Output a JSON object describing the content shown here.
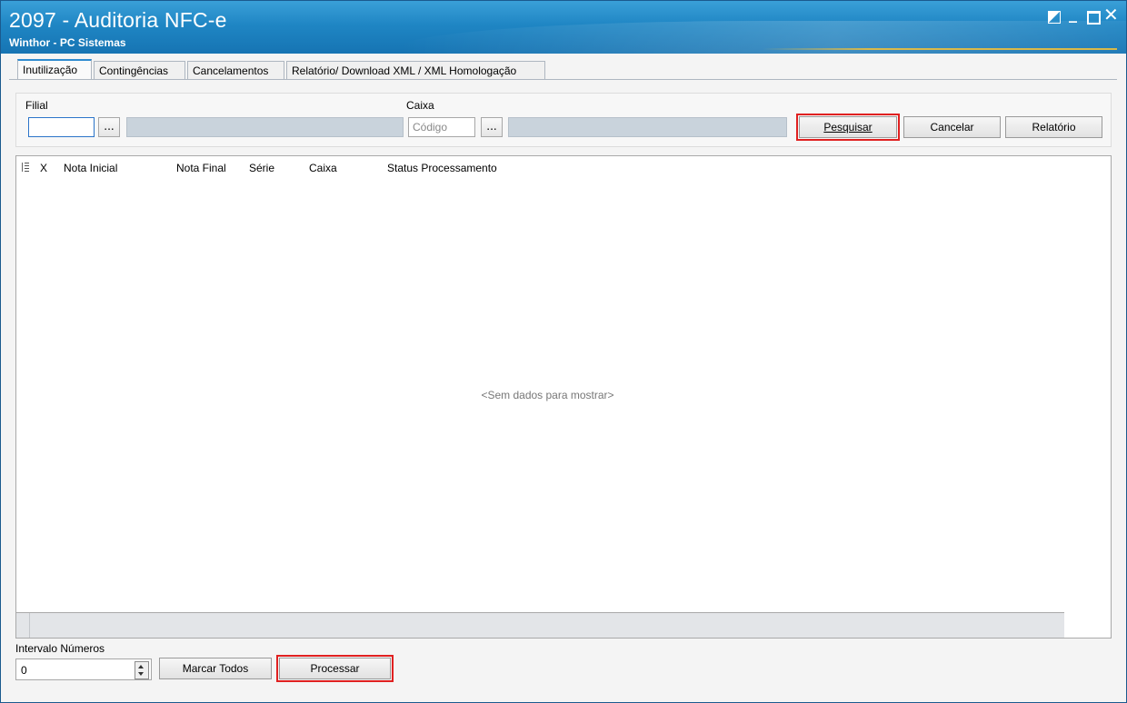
{
  "window": {
    "title": "2097 - Auditoria NFC-e",
    "subtitle": "Winthor - PC Sistemas"
  },
  "tabs": [
    {
      "label": "Inutilização",
      "active": true
    },
    {
      "label": "Contingências",
      "active": false
    },
    {
      "label": "Cancelamentos",
      "active": false
    },
    {
      "label": "Relatório/ Download XML / XML Homologação",
      "active": false
    }
  ],
  "filters": {
    "filial_label": "Filial",
    "filial_value": "",
    "ellipsis": "...",
    "caixa_label": "Caixa",
    "caixa_placeholder": "Código"
  },
  "actions": {
    "pesquisar": "Pesquisar",
    "cancelar": "Cancelar",
    "relatorio": "Relatório"
  },
  "grid": {
    "columns": [
      "X",
      "Nota Inicial",
      "Nota Final",
      "Série",
      "Caixa",
      "Status Processamento"
    ],
    "empty_text": "<Sem dados para mostrar>"
  },
  "footer": {
    "intervalo_label": "Intervalo Números",
    "intervalo_value": "0",
    "marcar_todos": "Marcar Todos",
    "processar": "Processar"
  },
  "colors": {
    "titlebar": "#1f86c4",
    "highlight": "#e02020",
    "readonly_field": "#c9d3dc"
  }
}
